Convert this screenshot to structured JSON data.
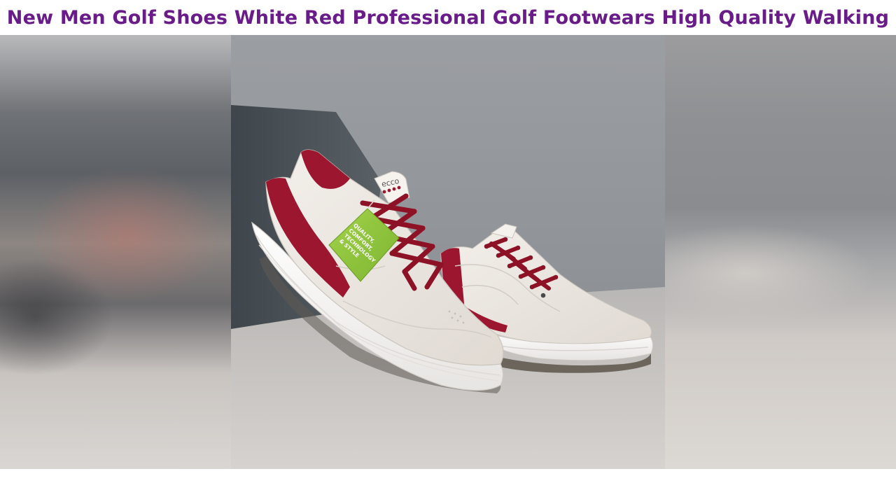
{
  "video": {
    "title": "New Men Golf Shoes White Red Professional Golf Footwears High Quality Walking",
    "title_color": "#6a1b8a"
  },
  "product_image": {
    "brand_logo_text": "ecco",
    "hang_tag_lines": [
      "QUALITY,",
      "COMFORT,",
      "TECHNOLOGY",
      "& STYLE"
    ],
    "colors": {
      "upper": "#ece7e1",
      "accent_red": "#9c1630",
      "laces": "#8e1226",
      "tag_green": "#8cc63f",
      "backdrop": "#8f9397",
      "floor": "#cfcbc8"
    }
  },
  "icons": {
    "shoe": "golf-shoe-icon",
    "tag": "hang-tag-icon"
  }
}
